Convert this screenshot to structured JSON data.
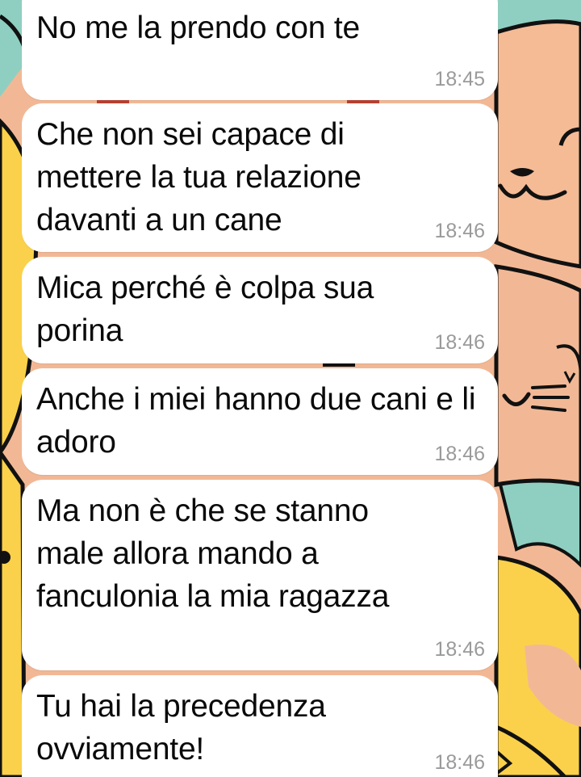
{
  "messages": [
    {
      "text": "No me la prendo con te",
      "time": "18:45"
    },
    {
      "text": "Che non sei capace di mettere la tua relazione davanti a un cane",
      "time": "18:46"
    },
    {
      "text": "Mica perché è colpa sua porina",
      "time": "18:46"
    },
    {
      "text": "Anche i miei hanno due cani e li adoro",
      "time": "18:46"
    },
    {
      "text": "Ma non è che se stanno male allora mando a fanculonia la mia ragazza",
      "time": "18:46"
    },
    {
      "text": "Tu hai la precedenza ovviamente!",
      "time": "18:46"
    }
  ],
  "colors": {
    "bubble": "#ffffff",
    "wallpaper_peach": "#f2b895",
    "wallpaper_yellow": "#fbd14b",
    "wallpaper_teal": "#8fcfc1",
    "timestamp": "#9a9a9a"
  },
  "icons": [
    "cat-wallpaper-illustration"
  ]
}
